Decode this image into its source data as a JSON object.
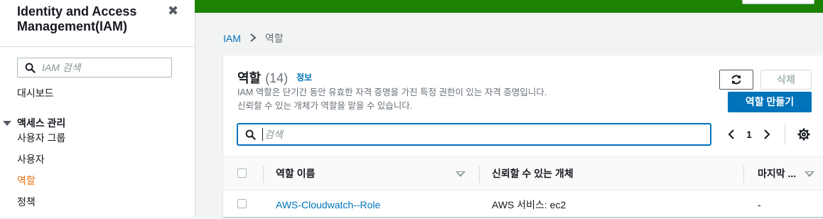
{
  "sidebar": {
    "title": "Identity and Access Management(IAM)",
    "close_icon": "✖",
    "search_placeholder": "IAM 검색",
    "dashboard": "대시보드",
    "section_access": "액세스 관리",
    "items": [
      {
        "label": "사용자 그룹",
        "active": false
      },
      {
        "label": "사용자",
        "active": false
      },
      {
        "label": "역할",
        "active": true
      },
      {
        "label": "정책",
        "active": false
      }
    ]
  },
  "breadcrumb": {
    "root": "IAM",
    "current": "역할"
  },
  "panel": {
    "title": "역할",
    "count": "(14)",
    "info_link": "정보",
    "description_line1": "IAM 역할은 단기간 동안 유효한 자격 증명을 가진 특정 권한이 있는 자격 증명입니다.",
    "description_line2": "신뢰할 수 있는 개체가 역할을 맡을 수 있습니다.",
    "delete_label": "삭제",
    "create_label": "역할 만들기",
    "search_placeholder": "검색"
  },
  "pagination": {
    "current_page": "1"
  },
  "table": {
    "columns": [
      "역할 이름",
      "신뢰할 수 있는 개체",
      "마지막 ..."
    ],
    "rows": [
      {
        "role_name": "AWS-Cloudwatch--Role",
        "trusted_entity": "AWS 서비스: ec2",
        "last_activity": "-"
      }
    ]
  },
  "colors": {
    "accent_blue": "#0073bb",
    "active_orange": "#ec7211",
    "banner_green": "#1d8102"
  },
  "icons": [
    "close-icon",
    "search-icon",
    "caret-down-icon",
    "chevron-right-icon",
    "refresh-icon",
    "chevron-left-icon",
    "gear-icon",
    "sort-icon"
  ]
}
